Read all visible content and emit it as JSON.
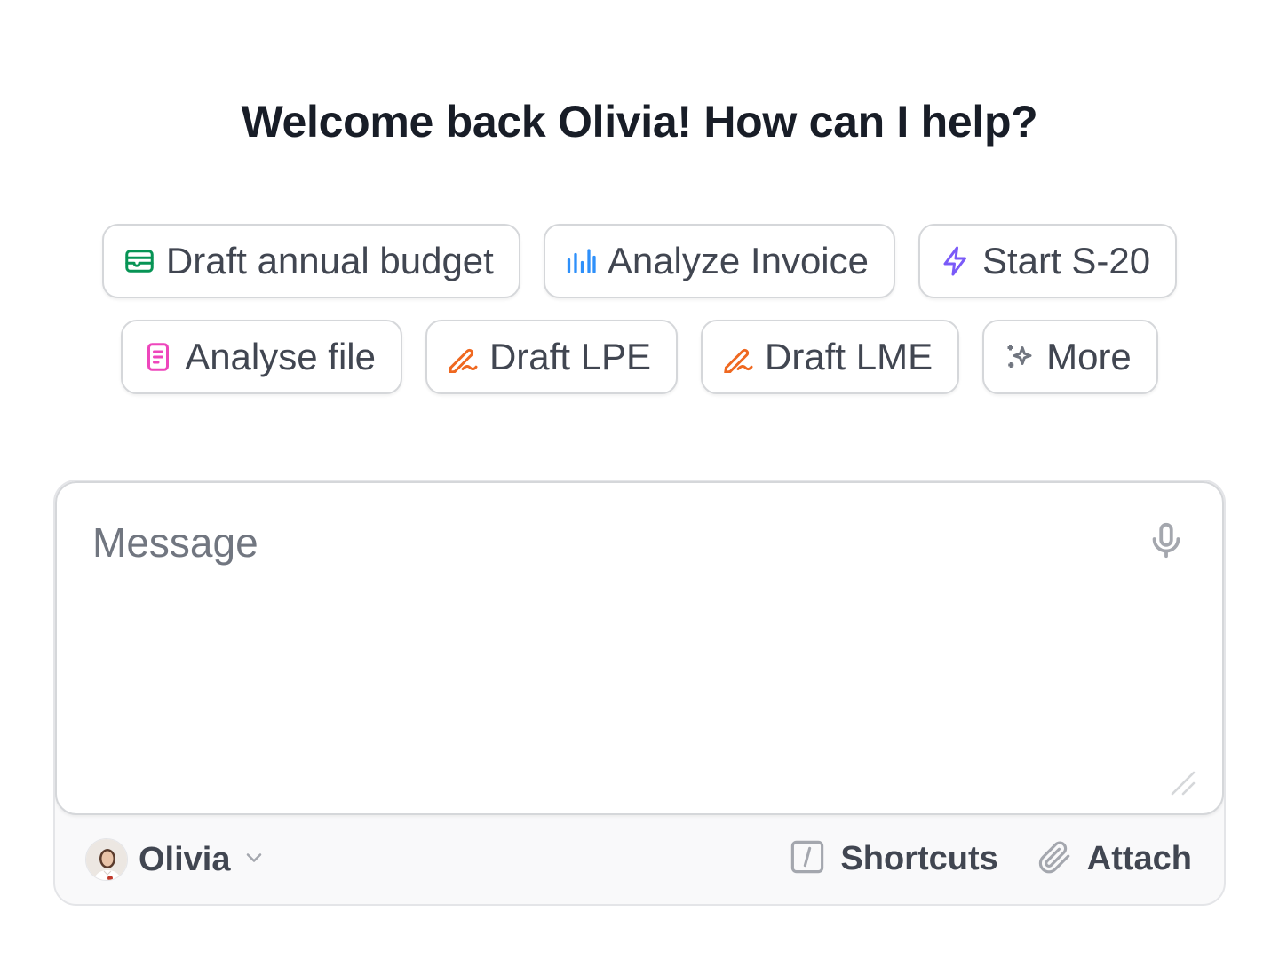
{
  "heading": "Welcome back Olivia! How can I help?",
  "suggestions": {
    "row1": [
      {
        "label": "Draft annual budget",
        "icon": "wallet-icon",
        "color": "#079455"
      },
      {
        "label": "Analyze Invoice",
        "icon": "bar-chart-icon",
        "color": "#2e90fa"
      },
      {
        "label": "Start S-20",
        "icon": "lightning-icon",
        "color": "#7a5af8"
      }
    ],
    "row2": [
      {
        "label": "Analyse file",
        "icon": "document-icon",
        "color": "#ee46bc"
      },
      {
        "label": "Draft LPE",
        "icon": "pen-icon",
        "color": "#ef6820"
      },
      {
        "label": "Draft LME",
        "icon": "pen-icon",
        "color": "#ef6820"
      },
      {
        "label": "More",
        "icon": "sparkles-icon",
        "color": "#717680"
      }
    ]
  },
  "composer": {
    "placeholder": "Message",
    "mic_icon": "microphone-icon",
    "user": {
      "name": "Olivia",
      "dropdown_icon": "chevron-down-icon"
    },
    "shortcuts_label": "Shortcuts",
    "attach_label": "Attach"
  }
}
